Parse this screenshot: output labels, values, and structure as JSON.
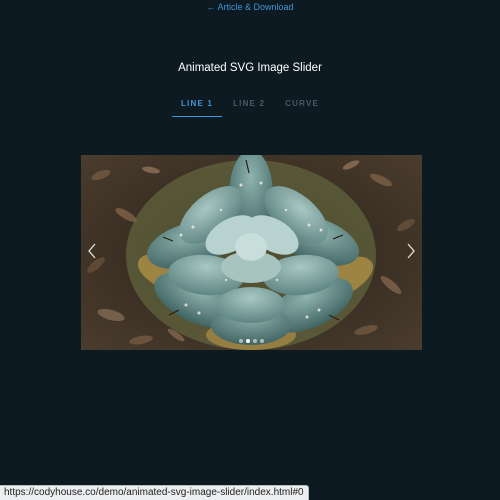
{
  "header": {
    "article_link": "← Article & Download"
  },
  "page_title": "Animated SVG Image Slider",
  "tabs": [
    {
      "label": "LINE 1",
      "active": true
    },
    {
      "label": "LINE 2",
      "active": false
    },
    {
      "label": "CURVE",
      "active": false
    }
  ],
  "slider": {
    "prev_icon": "chevron-left-icon",
    "next_icon": "chevron-right-icon",
    "dots_count": 4,
    "active_dot": 1
  },
  "status_bar": {
    "url": "https://codyhouse.co/demo/animated-svg-image-slider/index.html#0"
  },
  "colors": {
    "background": "#0d1a22",
    "accent": "#3f95d7",
    "inactive_tab": "#4a5963"
  }
}
